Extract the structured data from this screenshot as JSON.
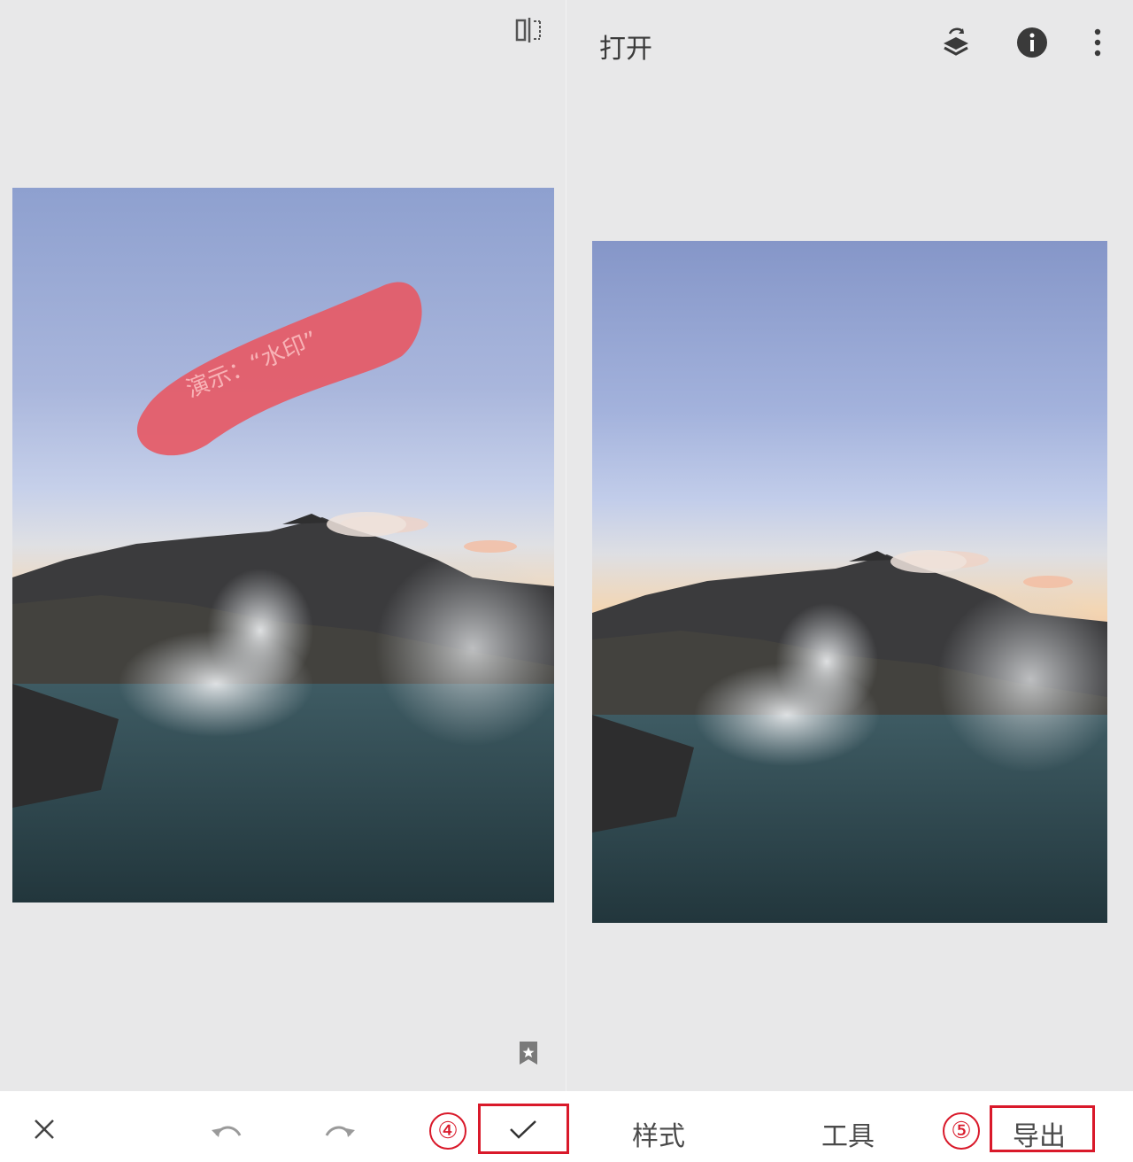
{
  "left_panel": {
    "watermark_text": "演示：“水印”",
    "toolbar": {
      "close_icon": "close-icon",
      "undo_icon": "undo-icon",
      "redo_icon": "redo-icon",
      "step_number": "④",
      "confirm_icon": "checkmark-icon"
    },
    "compare_icon": "compare-icon",
    "styles_icon": "bookmark-star-icon"
  },
  "right_panel": {
    "header": {
      "open_label": "打开",
      "icons": [
        "layers-icon",
        "info-icon",
        "more-vert-icon"
      ]
    },
    "bottom_tabs": {
      "styles_label": "样式",
      "tools_label": "工具",
      "step_number": "⑤",
      "export_label": "导出"
    }
  },
  "colors": {
    "annotation_red": "#d9192a",
    "watermark_fill": "#e65a66",
    "background": "#e8e8e9"
  }
}
